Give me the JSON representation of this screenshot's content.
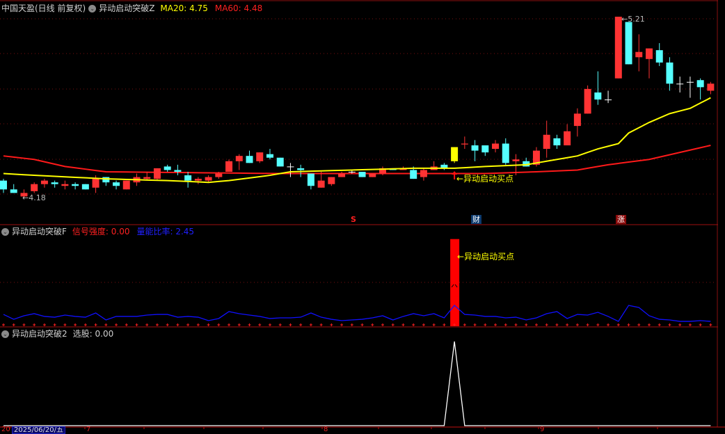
{
  "header": {
    "stock": "中国天盈(日线 前复权)",
    "indicator_main": "异动启动突破Z",
    "ma20_label": "MA20: 4.75",
    "ma60_label": "MA60: 4.48",
    "indicator_f": "异动启动突破F",
    "signal_label": "信号强度: 0.00",
    "volume_label": "量能比率: 2.45",
    "indicator_2": "异动启动突破2",
    "select_label": "选股: 0.00"
  },
  "annotations": {
    "low": "4.18",
    "high": "5.21",
    "buy_point": "异动启动买点",
    "buy_point_f": "异动启动买点",
    "arrow": "←",
    "event_s": "S",
    "event_cai": "财",
    "event_zhang": "涨"
  },
  "axis": {
    "date_prefix": "20",
    "date_cursor": "2025/06/20/五",
    "months": [
      "7",
      "8",
      "9"
    ]
  },
  "colors": {
    "up": "#ff3333",
    "down": "#55ffff",
    "doji": "#ffffff",
    "signal": "#ffff00",
    "ma20": "#ffff00",
    "ma60": "#ff1a1a",
    "volume": "#1010ff",
    "grid": "#7a1010"
  },
  "chart_data": [
    {
      "type": "candlestick",
      "title": "中国天盈(日线 前复权)",
      "signal_index": 44,
      "ylim": [
        4.18,
        5.21
      ],
      "ohlc": [
        [
          4.28,
          4.23,
          4.29,
          4.21
        ],
        [
          4.23,
          4.21,
          4.26,
          4.21
        ],
        [
          4.19,
          4.21,
          4.23,
          4.18
        ],
        [
          4.22,
          4.26,
          4.27,
          4.21
        ],
        [
          4.26,
          4.28,
          4.29,
          4.24
        ],
        [
          4.27,
          4.26,
          4.28,
          4.24
        ],
        [
          4.25,
          4.26,
          4.28,
          4.23
        ],
        [
          4.26,
          4.25,
          4.27,
          4.23
        ],
        [
          4.26,
          4.23,
          4.26,
          4.23
        ],
        [
          4.24,
          4.29,
          4.31,
          4.21
        ],
        [
          4.3,
          4.27,
          4.3,
          4.25
        ],
        [
          4.27,
          4.25,
          4.28,
          4.23
        ],
        [
          4.23,
          4.28,
          4.28,
          4.23
        ],
        [
          4.27,
          4.3,
          4.32,
          4.25
        ],
        [
          4.29,
          4.3,
          4.33,
          4.28
        ],
        [
          4.29,
          4.35,
          4.35,
          4.28
        ],
        [
          4.36,
          4.34,
          4.37,
          4.33
        ],
        [
          4.34,
          4.33,
          4.37,
          4.31
        ],
        [
          4.31,
          4.28,
          4.33,
          4.24
        ],
        [
          4.28,
          4.29,
          4.3,
          4.26
        ],
        [
          4.28,
          4.3,
          4.31,
          4.27
        ],
        [
          4.3,
          4.32,
          4.33,
          4.29
        ],
        [
          4.33,
          4.39,
          4.4,
          4.33
        ],
        [
          4.39,
          4.42,
          4.43,
          4.34
        ],
        [
          4.42,
          4.38,
          4.45,
          4.38
        ],
        [
          4.39,
          4.44,
          4.44,
          4.38
        ],
        [
          4.43,
          4.41,
          4.46,
          4.4
        ],
        [
          4.41,
          4.36,
          4.41,
          4.36
        ],
        [
          4.36,
          4.36,
          4.38,
          4.3
        ],
        [
          4.35,
          4.34,
          4.37,
          4.3
        ],
        [
          4.32,
          4.25,
          4.32,
          4.23
        ],
        [
          4.24,
          4.28,
          4.33,
          4.24
        ],
        [
          4.26,
          4.3,
          4.3,
          4.25
        ],
        [
          4.3,
          4.32,
          4.33,
          4.3
        ],
        [
          4.33,
          4.33,
          4.34,
          4.32
        ],
        [
          4.33,
          4.3,
          4.33,
          4.3
        ],
        [
          4.3,
          4.32,
          4.32,
          4.3
        ],
        [
          4.32,
          4.35,
          4.36,
          4.31
        ],
        [
          4.35,
          4.34,
          4.35,
          4.34
        ],
        [
          4.34,
          4.35,
          4.36,
          4.34
        ],
        [
          4.34,
          4.29,
          4.36,
          4.29
        ],
        [
          4.3,
          4.34,
          4.35,
          4.28
        ],
        [
          4.34,
          4.36,
          4.39,
          4.34
        ],
        [
          4.37,
          4.35,
          4.38,
          4.34
        ],
        [
          4.39,
          4.47,
          4.47,
          4.38
        ],
        [
          4.485,
          4.49,
          4.53,
          4.46
        ],
        [
          4.48,
          4.45,
          4.51,
          4.39
        ],
        [
          4.48,
          4.44,
          4.48,
          4.42
        ],
        [
          4.46,
          4.49,
          4.51,
          4.44
        ],
        [
          4.49,
          4.38,
          4.52,
          4.37
        ],
        [
          4.39,
          4.4,
          4.43,
          4.31
        ],
        [
          4.39,
          4.36,
          4.41,
          4.36
        ],
        [
          4.37,
          4.45,
          4.47,
          4.36
        ],
        [
          4.46,
          4.54,
          4.62,
          4.41
        ],
        [
          4.52,
          4.48,
          4.54,
          4.46
        ],
        [
          4.48,
          4.56,
          4.6,
          4.48
        ],
        [
          4.59,
          4.66,
          4.69,
          4.53
        ],
        [
          4.66,
          4.8,
          4.82,
          4.66
        ],
        [
          4.78,
          4.74,
          4.9,
          4.71
        ],
        [
          4.74,
          4.74,
          4.79,
          4.72
        ],
        [
          4.86,
          5.21,
          5.21,
          4.86
        ],
        [
          5.18,
          4.94,
          5.18,
          4.94
        ],
        [
          4.98,
          5.01,
          5.11,
          4.9
        ],
        [
          4.97,
          5.03,
          5.03,
          4.86
        ],
        [
          5.02,
          4.95,
          5.06,
          4.93
        ],
        [
          4.95,
          4.83,
          4.98,
          4.79
        ],
        [
          4.83,
          4.83,
          4.87,
          4.78
        ],
        [
          4.84,
          4.84,
          4.87,
          4.75
        ],
        [
          4.85,
          4.81,
          4.86,
          4.74
        ],
        [
          4.79,
          4.83,
          4.84,
          4.77
        ]
      ],
      "ma20_points": [
        [
          0,
          4.32
        ],
        [
          3,
          4.31
        ],
        [
          10,
          4.29
        ],
        [
          16,
          4.28
        ],
        [
          20,
          4.27
        ],
        [
          22,
          4.28
        ],
        [
          26,
          4.31
        ],
        [
          28,
          4.33
        ],
        [
          34,
          4.34
        ],
        [
          40,
          4.35
        ],
        [
          44,
          4.35
        ],
        [
          47,
          4.36
        ],
        [
          51,
          4.37
        ],
        [
          53,
          4.39
        ],
        [
          56,
          4.42
        ],
        [
          58,
          4.46
        ],
        [
          60,
          4.49
        ],
        [
          61,
          4.55
        ],
        [
          63,
          4.61
        ],
        [
          65,
          4.66
        ],
        [
          67,
          4.69
        ],
        [
          68,
          4.72
        ],
        [
          69,
          4.75
        ]
      ],
      "ma60_points": [
        [
          0,
          4.42
        ],
        [
          3,
          4.4
        ],
        [
          6,
          4.36
        ],
        [
          10,
          4.33
        ],
        [
          27,
          4.32
        ],
        [
          47,
          4.32
        ],
        [
          52,
          4.33
        ],
        [
          56,
          4.34
        ],
        [
          59,
          4.37
        ],
        [
          63,
          4.4
        ],
        [
          66,
          4.44
        ],
        [
          69,
          4.48
        ]
      ]
    },
    {
      "type": "bar+line",
      "title": "异动启动突破F",
      "signal_strength": {
        "index": 44,
        "value": 9.0
      },
      "ylim": [
        0,
        10
      ],
      "volume_ratio": [
        1.09,
        0.58,
        0.95,
        1.17,
        0.88,
        0.8,
        1.02,
        0.88,
        0.8,
        1.24,
        0.51,
        0.88,
        0.88,
        0.88,
        1.02,
        1.09,
        1.09,
        0.8,
        0.88,
        0.8,
        0.44,
        0.66,
        1.39,
        1.17,
        1.02,
        0.88,
        0.66,
        0.73,
        0.73,
        0.8,
        1.24,
        0.8,
        0.58,
        0.44,
        0.51,
        0.58,
        0.73,
        0.95,
        0.51,
        0.88,
        1.17,
        0.95,
        1.17,
        0.73,
        2.04,
        1.09,
        1.02,
        0.88,
        0.88,
        0.73,
        0.8,
        0.51,
        0.73,
        1.17,
        1.39,
        0.66,
        1.09,
        1.02,
        1.31,
        0.88,
        0.36,
        2.04,
        1.82,
        0.95,
        0.58,
        0.51,
        0.36,
        0.36,
        0.44,
        0.36
      ]
    },
    {
      "type": "line",
      "title": "异动启动突破2",
      "ylim": [
        0,
        1
      ],
      "select_signal_index": 44,
      "select_value_at_signal": 1
    }
  ]
}
